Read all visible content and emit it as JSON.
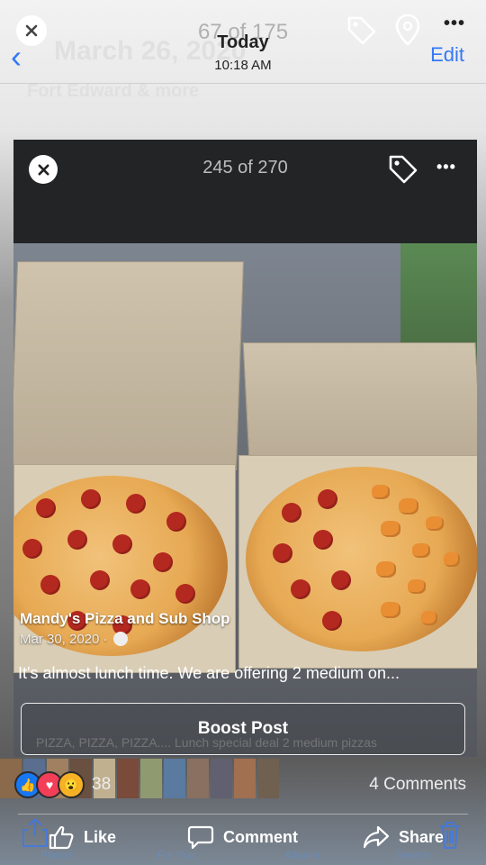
{
  "background": {
    "counter": "67 of 175",
    "date_title": "Today",
    "time": "10:18 AM",
    "blurred_title": "March 26, 2020",
    "blurred_location": "Fort Edward & more",
    "edit_label": "Edit",
    "tabs": [
      "Photos",
      "For You",
      "Albums",
      "Search"
    ]
  },
  "photo_viewer": {
    "counter": "245 of 270"
  },
  "post": {
    "author": "Mandy's Pizza and Sub Shop",
    "date": "Mar 30, 2020 ·",
    "text": "It's almost lunch time. We are offering 2 medium on...",
    "boost_label": "Boost Post",
    "blurred_text": "PIZZA, PIZZA, PIZZA.... Lunch special deal 2 medium pizzas"
  },
  "reactions": {
    "count": "38",
    "comments": "4 Comments"
  },
  "actions": {
    "like": "Like",
    "comment": "Comment",
    "share": "Share"
  },
  "colors": {
    "link_blue": "#3478f6",
    "like_blue": "#1877f2",
    "love_red": "#f33e58",
    "wow_yellow": "#f7b125"
  }
}
